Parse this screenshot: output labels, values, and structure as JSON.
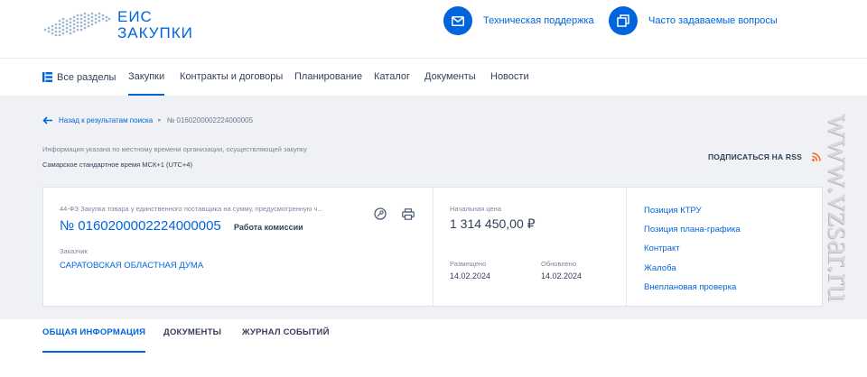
{
  "logo": {
    "line1": "ЕИС",
    "line2": "ЗАКУПКИ"
  },
  "header": {
    "support": "Техническая поддержка",
    "faq": "Часто задаваемые вопросы"
  },
  "nav": {
    "all": "Все разделы",
    "items": [
      "Закупки",
      "Контракты и договоры",
      "Планирование",
      "Каталог",
      "Документы",
      "Новости"
    ],
    "active": "Закупки"
  },
  "breadcrumb": {
    "back": "Назад к результатам поиска",
    "current": "№ 0160200002224000005"
  },
  "timezone": {
    "note": "Информация указана по местному времени организации, осуществляющей закупку",
    "value": "Самарское стандартное время МСК+1 (UTC+4)"
  },
  "rss": {
    "label": "ПОДПИСАТЬСЯ НА RSS"
  },
  "card": {
    "law_text": "44-ФЗ Закупка товара у единственного поставщика на сумму, предусмотренную ч...",
    "reg_number": "№ 0160200002224000005",
    "stage": "Работа комиссии",
    "customer_label": "Заказчик",
    "customer": "САРАТОВСКАЯ ОБЛАСТНАЯ ДУМА",
    "price_label": "Начальная цена",
    "price": "1 314 450,00 ₽",
    "posted_label": "Размещено",
    "posted": "14.02.2024",
    "updated_label": "Обновлено",
    "updated": "14.02.2024",
    "links": [
      "Позиция КТРУ",
      "Позиция плана-графика",
      "Контракт",
      "Жалоба",
      "Внеплановая проверка"
    ]
  },
  "tabs": [
    "ОБЩАЯ ИНФОРМАЦИЯ",
    "ДОКУМЕНТЫ",
    "ЖУРНАЛ СОБЫТИЙ"
  ],
  "watermark": "www.vzsar.ru",
  "colors": {
    "accent": "#0065dd",
    "text": "#334059",
    "muted": "#7b869b",
    "background": "#eff1f4",
    "rss": "#f26522"
  }
}
